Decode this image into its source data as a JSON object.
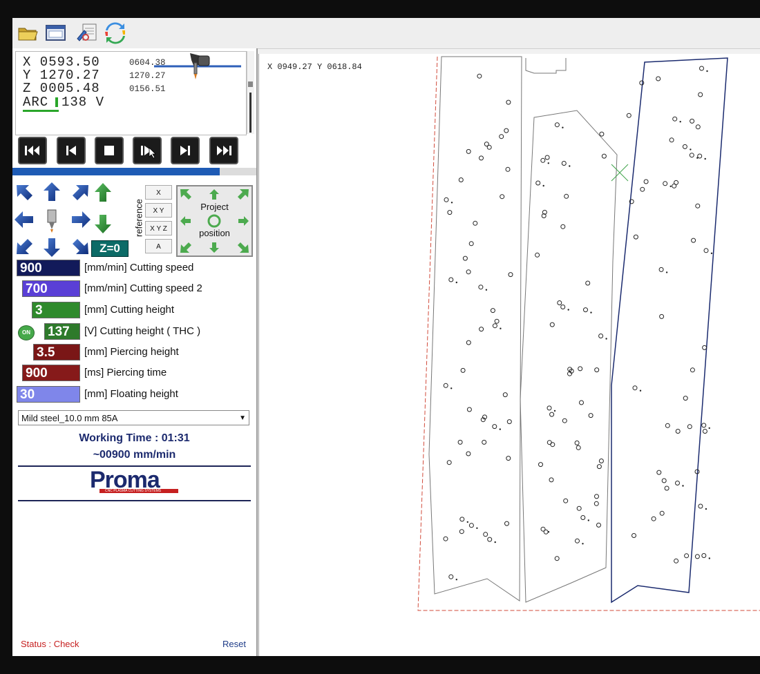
{
  "toolbar": {
    "icons": [
      "folder-open-icon",
      "window-icon",
      "config-icon",
      "refresh-icon"
    ]
  },
  "dro": {
    "x": "X 0593.50",
    "y": "Y 1270.27",
    "z": "Z 0005.48",
    "x_sub": "0604.38",
    "y_sub": "1270.27",
    "z_sub": "0156.51",
    "arc": "ARC",
    "arc_value": "138 V"
  },
  "transport": [
    "skip-back-icon",
    "step-back-icon",
    "stop-icon",
    "play-icon",
    "step-forward-icon",
    "skip-forward-icon"
  ],
  "progress": 0.85,
  "jog": {
    "reference_label": "reference",
    "ref_buttons": [
      "X",
      "X Y",
      "X Y Z",
      "A"
    ],
    "project_label_top": "Project",
    "project_label_bottom": "position",
    "zero_label": "Z=0"
  },
  "params": [
    {
      "value": "900",
      "label": "[mm/min] Cutting speed",
      "color": "#121a5a"
    },
    {
      "value": "700",
      "label": "[mm/min] Cutting speed 2",
      "color": "#5a3fd6"
    },
    {
      "value": "3",
      "label": "[mm] Cutting height",
      "color": "#2f8a2c"
    },
    {
      "value": "137",
      "label": "[V] Cutting height ( THC )",
      "color": "#2e7a2b"
    },
    {
      "value": "3.5",
      "label": "[mm] Piercing height",
      "color": "#7a1616"
    },
    {
      "value": "900",
      "label": "[ms] Piercing time",
      "color": "#861a1a"
    },
    {
      "value": "30",
      "label": "[mm] Floating height",
      "color": "#7f86ea"
    }
  ],
  "thc_toggle": "ON",
  "material": "Mild steel_10.0 mm 85A",
  "working_time": "Working Time : 01:31",
  "feed": "~00900 mm/min",
  "logo": {
    "main": "Proma",
    "sub": "CNC PLASMA CUTTING SYSTEMS"
  },
  "status": "Status : Check",
  "reset": "Reset",
  "canvas": {
    "coord": "X 0949.27  Y 0618.84"
  }
}
